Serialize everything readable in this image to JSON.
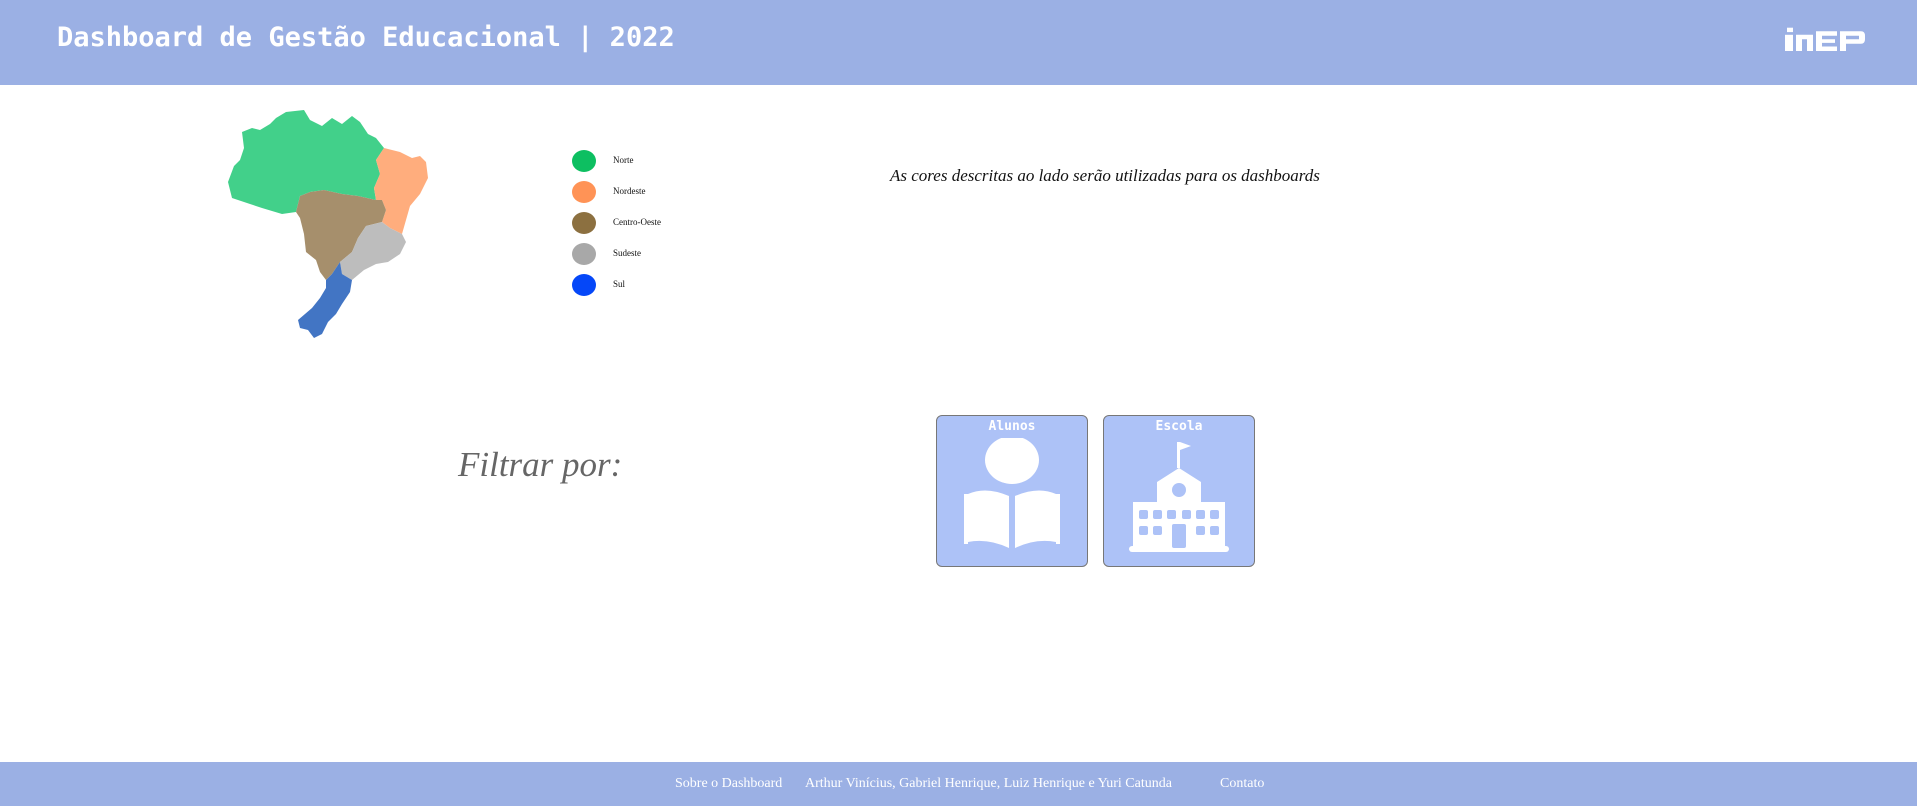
{
  "header": {
    "title": "Dashboard de Gestão Educacional | 2022",
    "logo_text": "INEP"
  },
  "legend": {
    "items": [
      {
        "label": "Norte",
        "color": "#0dbf61"
      },
      {
        "label": "Nordeste",
        "color": "#ff9356"
      },
      {
        "label": "Centro-Oeste",
        "color": "#8c7040"
      },
      {
        "label": "Sudeste",
        "color": "#a8a8a8"
      },
      {
        "label": "Sul",
        "color": "#0547f8"
      }
    ]
  },
  "map_colors": {
    "norte": "#42d08a",
    "nordeste": "#ffad7d",
    "centro_oeste": "#a68f6c",
    "sudeste": "#bdbdbd",
    "sul": "#4275c4"
  },
  "note": "As cores descritas ao lado serão utilizadas para os dashboards",
  "filter": {
    "label": "Filtrar por:",
    "cards": [
      {
        "label": "Alunos",
        "icon": "student-reading-icon"
      },
      {
        "label": "Escola",
        "icon": "school-building-icon"
      }
    ]
  },
  "footer": {
    "about": "Sobre o Dashboard",
    "authors": "Arthur Vinícius, Gabriel Henrique, Luiz Henrique e Yuri Catunda",
    "contact": "Contato"
  },
  "colors": {
    "header_bg": "#9bb0e4",
    "card_bg": "#adc2f7"
  }
}
